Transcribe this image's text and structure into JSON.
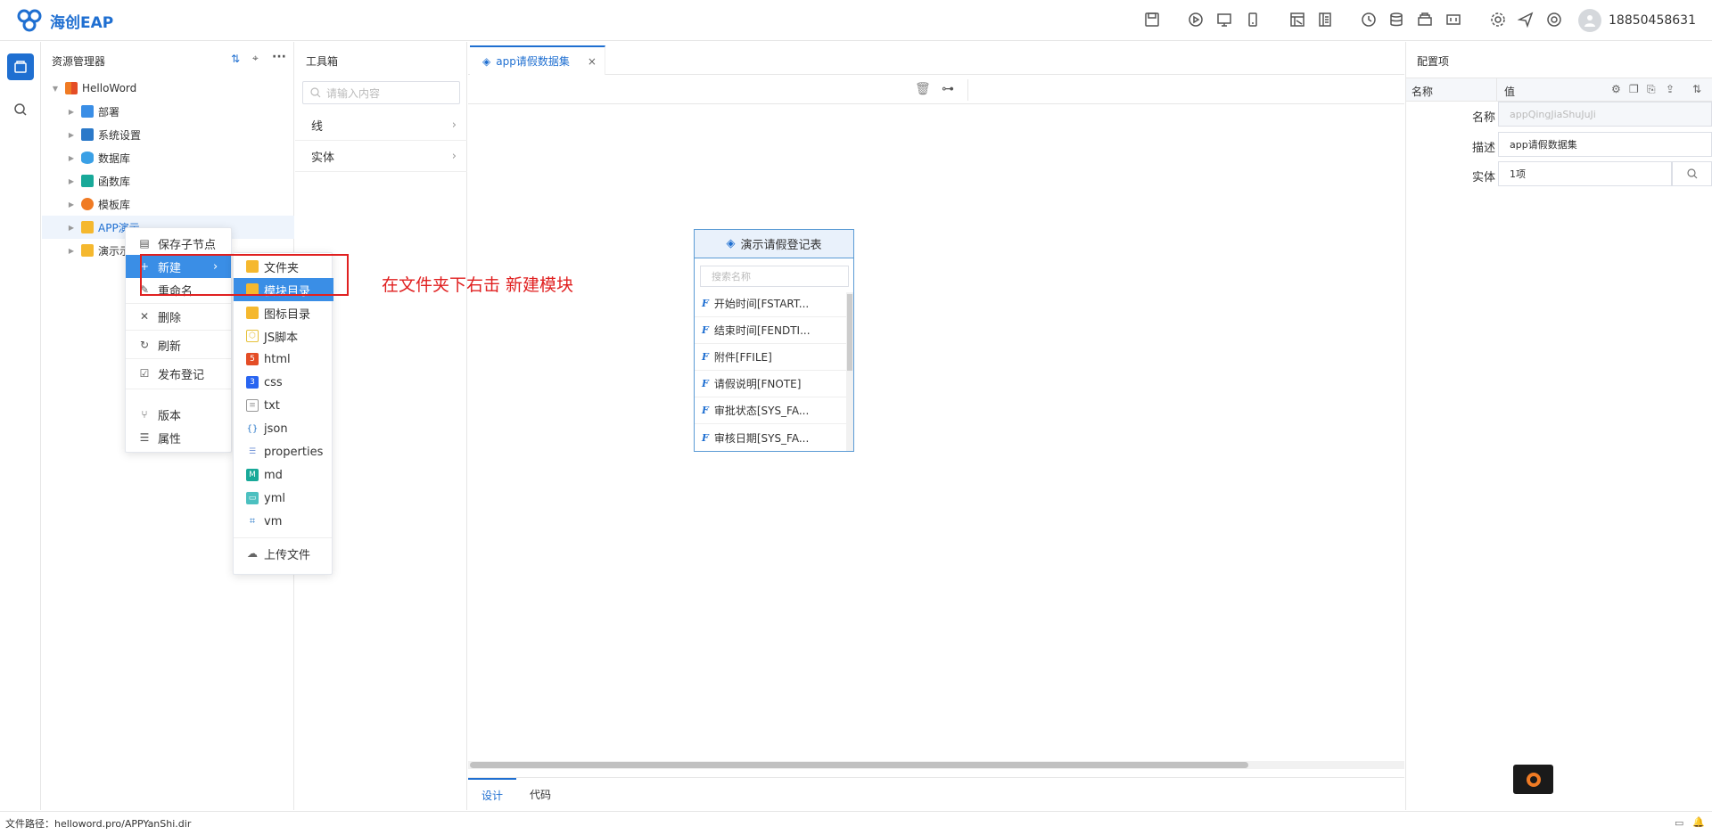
{
  "app": {
    "name": "海创EAP"
  },
  "user": {
    "phone": "18850458631"
  },
  "topbar_icons": [
    "save-icon",
    "run-icon",
    "desktop-icon",
    "mobile-icon",
    "design-icon",
    "doc-icon",
    "history-icon",
    "database-icon",
    "component-icon",
    "ui-icon",
    "settings-icon",
    "send-icon",
    "help-icon"
  ],
  "explorer": {
    "title": "资源管理器",
    "root": "HelloWord",
    "items": [
      {
        "label": "部署",
        "color": "#3a8ee6"
      },
      {
        "label": "系统设置",
        "color": "#2b79c9"
      },
      {
        "label": "数据库",
        "color": "#3aa0e6"
      },
      {
        "label": "函数库",
        "color": "#18a999"
      },
      {
        "label": "模板库",
        "color": "#f07b24"
      },
      {
        "label": "APP演示",
        "color": "#f5b82e"
      },
      {
        "label": "演示示",
        "color": "#f5b82e"
      }
    ]
  },
  "toolbox": {
    "title": "工具箱",
    "search_placeholder": "请输入内容",
    "groups": [
      "线",
      "实体"
    ]
  },
  "editor": {
    "tab_label": "app请假数据集",
    "bottom_tabs": [
      "设计",
      "代码"
    ]
  },
  "entity": {
    "title": "演示请假登记表",
    "search_placeholder": "搜索名称",
    "fields": [
      "开始时间[FSTART...",
      "结束时间[FENDTI...",
      "附件[FFILE]",
      "请假说明[FNOTE]",
      "审批状态[SYS_FA...",
      "审核日期[SYS_FA..."
    ]
  },
  "config": {
    "title": "配置项",
    "col_name": "名称",
    "col_value": "值",
    "rows": [
      {
        "label": "名称",
        "value": "appQingJiaShuJuJi"
      },
      {
        "label": "描述",
        "value": "app请假数据集"
      },
      {
        "label": "实体",
        "value": "1项"
      }
    ]
  },
  "context_menu": {
    "items": [
      "保存子节点",
      "新建",
      "重命名",
      "删除",
      "刷新",
      "发布登记",
      "版本",
      "属性"
    ]
  },
  "submenu": {
    "items": [
      {
        "label": "文件夹",
        "color": "#f5b82e"
      },
      {
        "label": "模块目录",
        "color": "#f5b82e"
      },
      {
        "label": "图标目录",
        "color": "#f5b82e"
      },
      {
        "label": "JS脚本",
        "color": "#e6c13a"
      },
      {
        "label": "html",
        "color": "#e44d26"
      },
      {
        "label": "css",
        "color": "#2965f1"
      },
      {
        "label": "txt",
        "color": "#999999"
      },
      {
        "label": "json",
        "color": "#2b79c9"
      },
      {
        "label": "properties",
        "color": "#6d8fd6"
      },
      {
        "label": "md",
        "color": "#18a999"
      },
      {
        "label": "yml",
        "color": "#4cc0c0"
      },
      {
        "label": "vm",
        "color": "#2b79c9"
      },
      {
        "label": "上传文件",
        "color": "#666666"
      }
    ]
  },
  "annotation": "在文件夹下右击 新建模块",
  "status": {
    "path": "文件路径：helloword.pro/APPYanShi.dir"
  },
  "colors": {
    "accent": "#1f6fd1",
    "highlight": "#e02020",
    "menu_active": "#3a8ee6"
  }
}
